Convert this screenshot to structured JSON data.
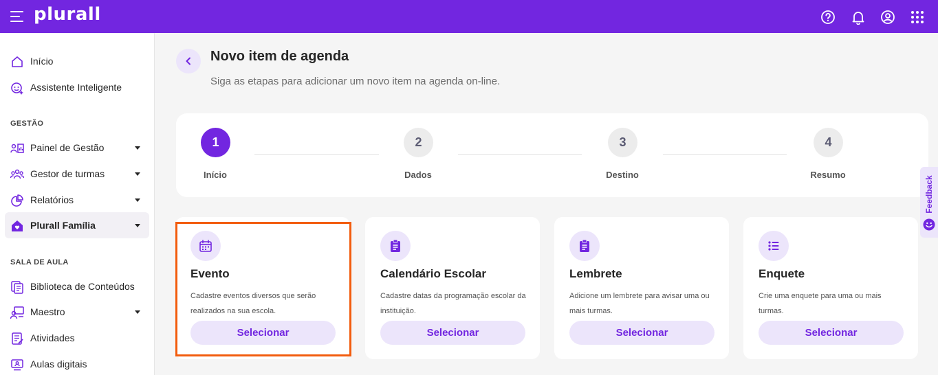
{
  "app": {
    "brand": "plurall"
  },
  "colors": {
    "primary": "#7226e0",
    "accent_light": "#ece5fb",
    "highlight": "#f25c0d"
  },
  "topbar_icons": [
    "help-icon",
    "bell-icon",
    "user-icon",
    "apps-grid-icon"
  ],
  "sidebar": {
    "top_items": [
      {
        "label": "Início",
        "icon": "home-icon"
      },
      {
        "label": "Assistente Inteligente",
        "icon": "assistant-icon"
      }
    ],
    "gestao_label": "GESTÃO",
    "gestao_items": [
      {
        "label": "Painel de Gestão",
        "icon": "dashboard-icon",
        "expandable": true
      },
      {
        "label": "Gestor de turmas",
        "icon": "people-icon",
        "expandable": true
      },
      {
        "label": "Relatórios",
        "icon": "pie-chart-icon",
        "expandable": true
      },
      {
        "label": "Plurall Família",
        "icon": "family-home-icon",
        "expandable": true,
        "active": true
      }
    ],
    "sala_label": "SALA DE AULA",
    "sala_items": [
      {
        "label": "Biblioteca de Conteúdos",
        "icon": "library-icon"
      },
      {
        "label": "Maestro",
        "icon": "teacher-icon",
        "expandable": true
      },
      {
        "label": "Atividades",
        "icon": "activities-icon"
      },
      {
        "label": "Aulas digitais",
        "icon": "digital-class-icon"
      }
    ]
  },
  "header": {
    "title": "Novo item de agenda",
    "subtitle": "Siga as etapas para adicionar um novo item na agenda on-line."
  },
  "stepper": {
    "current_step": 1,
    "steps": [
      {
        "number": "1",
        "label": "Início"
      },
      {
        "number": "2",
        "label": "Dados"
      },
      {
        "number": "3",
        "label": "Destino"
      },
      {
        "number": "4",
        "label": "Resumo"
      }
    ]
  },
  "cards": [
    {
      "icon": "calendar-icon",
      "title": "Evento",
      "description": "Cadastre eventos diversos que serão realizados na sua escola.",
      "button": "Selecionar",
      "highlighted": true
    },
    {
      "icon": "clipboard-icon",
      "title": "Calendário Escolar",
      "description": "Cadastre datas da programação escolar da instituição.",
      "button": "Selecionar"
    },
    {
      "icon": "clipboard-icon",
      "title": "Lembrete",
      "description": "Adicione um lembrete para avisar uma ou mais turmas.",
      "button": "Selecionar"
    },
    {
      "icon": "list-icon",
      "title": "Enquete",
      "description": "Crie uma enquete para uma ou mais turmas.",
      "button": "Selecionar"
    }
  ],
  "feedback_tab": {
    "label": "Feedback"
  }
}
